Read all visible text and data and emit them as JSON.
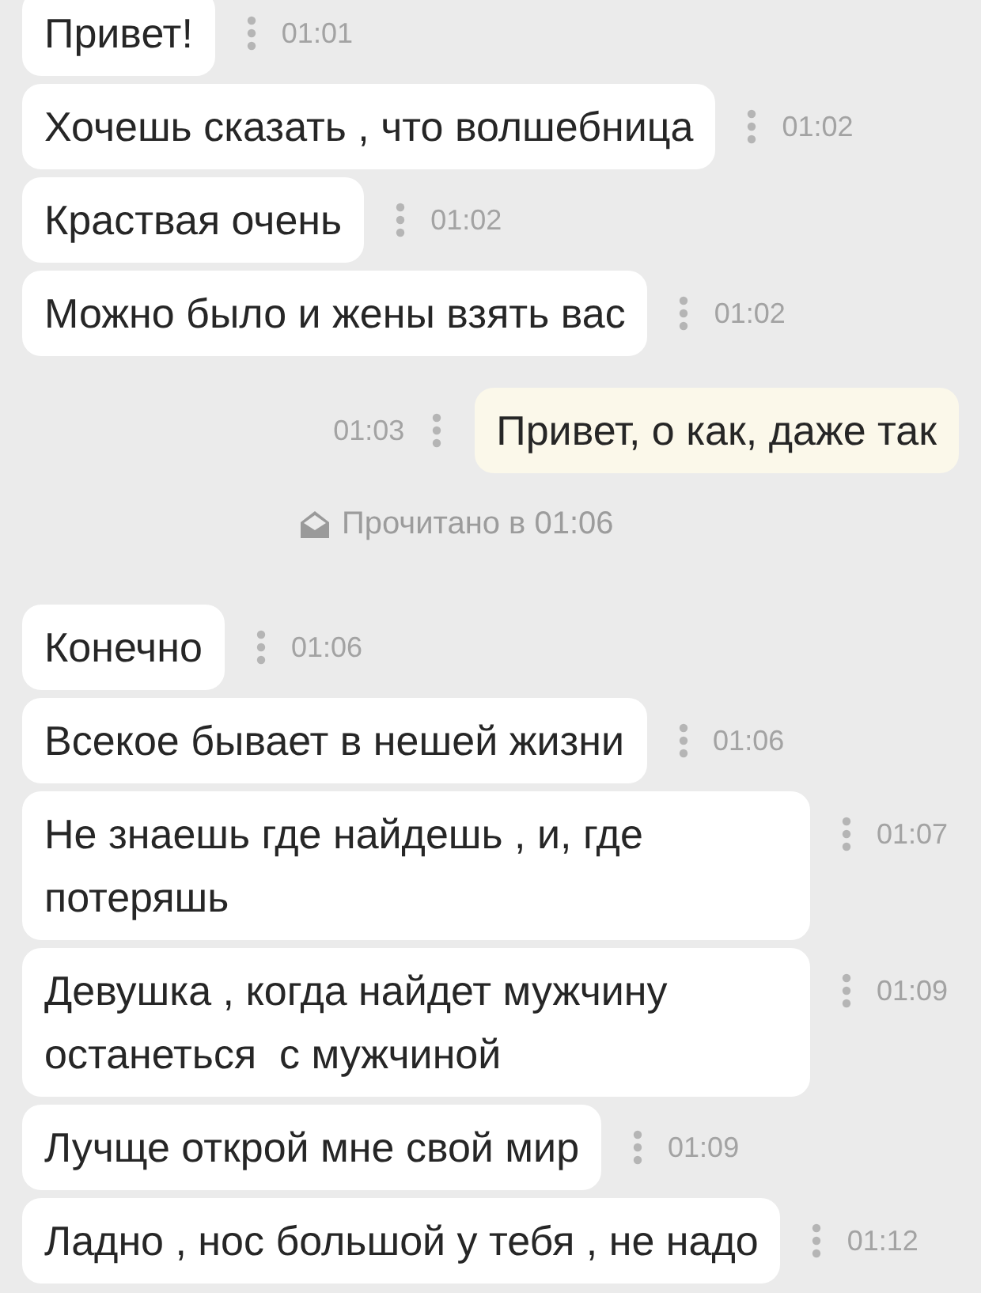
{
  "messages": [
    {
      "kind": "incoming",
      "text": "Привет!",
      "time": "01:01"
    },
    {
      "kind": "incoming",
      "text": "Хочешь сказать , что волшебница",
      "time": "01:02"
    },
    {
      "kind": "incoming",
      "text": "Краствая очень",
      "time": "01:02"
    },
    {
      "kind": "incoming",
      "text": "Можно было и жены взять вас",
      "time": "01:02"
    },
    {
      "kind": "outgoing",
      "text": "Привет, о как, даже так",
      "time": "01:03"
    },
    {
      "kind": "read_receipt",
      "text": "Прочитано в 01:06"
    },
    {
      "kind": "incoming",
      "text": "Конечно",
      "time": "01:06"
    },
    {
      "kind": "incoming",
      "text": "Всекое бывает в нешей жизни",
      "time": "01:06"
    },
    {
      "kind": "incoming",
      "text": "Не знаешь где найдешь , и, где потеряшь",
      "time": "01:07"
    },
    {
      "kind": "incoming",
      "text": "Девушка , когда найдет мужчину останеться  с мужчиной",
      "time": "01:09"
    },
    {
      "kind": "incoming",
      "text": "Лучще открой мне свой мир",
      "time": "01:09"
    },
    {
      "kind": "incoming",
      "text": "Ладно , нос большой у тебя , не надо",
      "time": "01:12"
    }
  ]
}
